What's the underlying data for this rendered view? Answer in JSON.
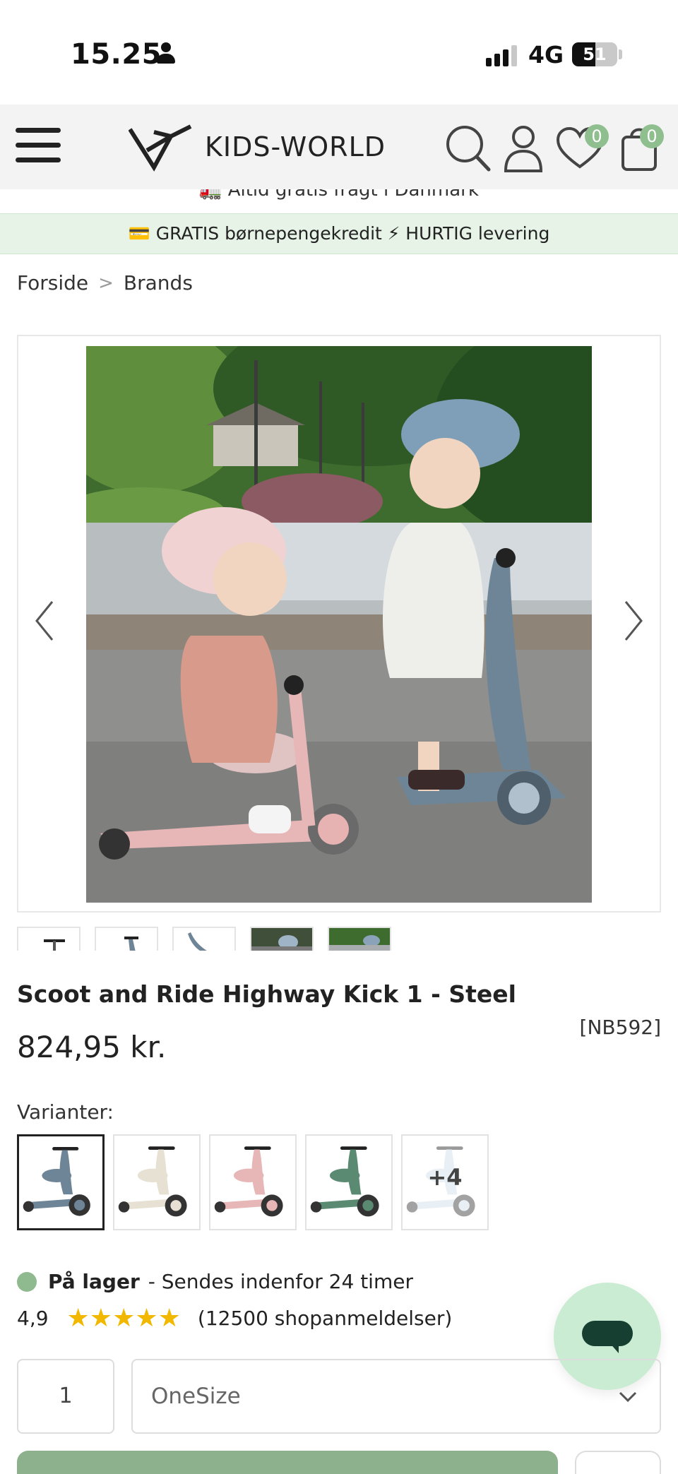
{
  "status_bar": {
    "time": "15.25",
    "network": "4G",
    "battery": "51",
    "battery_level": 0.51,
    "signal_bars": 3
  },
  "header": {
    "brand": "KIDS-WORLD",
    "wishlist_count": "0",
    "cart_count": "0"
  },
  "banners": {
    "shipping": "🚛 Altid gratis fragt i Danmark",
    "promo": "💳 GRATIS børnepengekredit ⚡ HURTIG levering"
  },
  "breadcrumb": {
    "home": "Forside",
    "separator": ">",
    "current": "Brands"
  },
  "product": {
    "title": "Scoot and Ride Highway Kick 1 - Steel",
    "sku": "[NB592]",
    "price": "824,95 kr.",
    "variants_label": "Varianter:",
    "variants": [
      {
        "name": "steel",
        "color": "#6e8597",
        "selected": true
      },
      {
        "name": "ash",
        "color": "#e6e1d2",
        "selected": false
      },
      {
        "name": "rose",
        "color": "#e7b6b6",
        "selected": false
      },
      {
        "name": "forest",
        "color": "#5a8a72",
        "selected": false
      },
      {
        "name": "more",
        "color": "#cfe0ea",
        "selected": false,
        "overlay": "+4"
      }
    ],
    "stock_status": "På lager",
    "stock_note": "- Sendes indenfor 24 timer",
    "rating": "4,9",
    "stars": "★★★★★",
    "reviews": "(12500 shopanmeldelser)",
    "quantity": "1",
    "size": "OneSize"
  },
  "colors": {
    "accent_green": "#8fbf8f",
    "promo_bg": "#e6f3e6",
    "chat_bg": "#c9ecd2",
    "chat_icon": "#163f31",
    "star": "#f2b800"
  }
}
